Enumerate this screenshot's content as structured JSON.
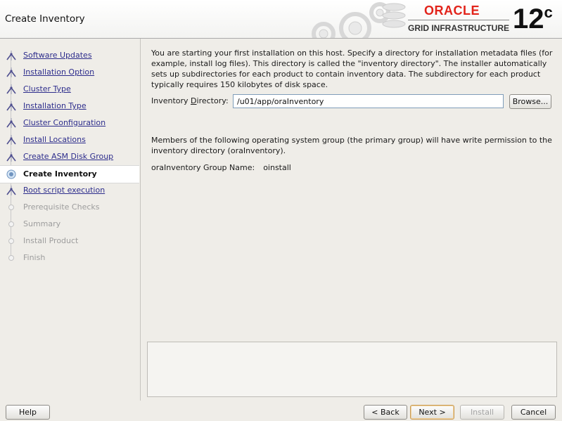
{
  "header": {
    "title": "Create Inventory",
    "brand": "ORACLE",
    "product": "GRID INFRASTRUCTURE",
    "version": "12",
    "version_suffix": "c",
    "brand_color": "#e2231a"
  },
  "steps": [
    {
      "label": "Software Updates",
      "state": "done"
    },
    {
      "label": "Installation Option",
      "state": "done"
    },
    {
      "label": "Cluster Type",
      "state": "done"
    },
    {
      "label": "Installation Type",
      "state": "done"
    },
    {
      "label": "Cluster Configuration",
      "state": "done"
    },
    {
      "label": "Install Locations",
      "state": "done"
    },
    {
      "label": "Create ASM Disk Group",
      "state": "done"
    },
    {
      "label": "Create Inventory",
      "state": "current"
    },
    {
      "label": "Root script execution",
      "state": "done"
    },
    {
      "label": "Prerequisite Checks",
      "state": "future"
    },
    {
      "label": "Summary",
      "state": "future"
    },
    {
      "label": "Install Product",
      "state": "future"
    },
    {
      "label": "Finish",
      "state": "future"
    }
  ],
  "main": {
    "intro": "You are starting your first installation on this host. Specify a directory for installation metadata files (for example, install log files). This directory is called the \"inventory directory\". The installer automatically sets up subdirectories for each product to contain inventory data. The subdirectory for each product typically requires 150 kilobytes of disk space.",
    "dir_label_pre": "Inventory ",
    "dir_label_mnemonic": "D",
    "dir_label_post": "irectory:",
    "dir_value": "/u01/app/oraInventory",
    "browse_label": "Browse...",
    "members_text": "Members of the following operating system group (the primary group) will have write permission to the inventory directory (oraInventory).",
    "group_label": "oraInventory Group Name:",
    "group_value": "oinstall"
  },
  "footer": {
    "help": "Help",
    "back": "< Back",
    "next": "Next >",
    "install": "Install",
    "cancel": "Cancel"
  }
}
